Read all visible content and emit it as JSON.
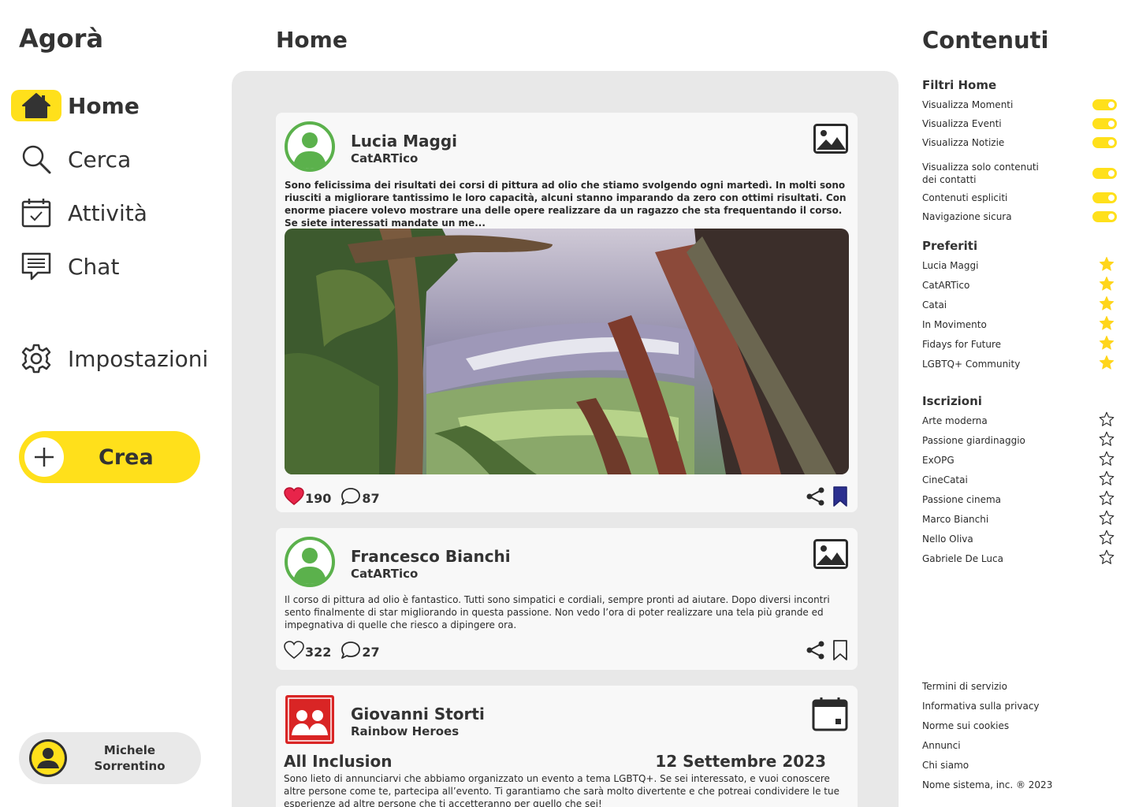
{
  "brand": "Agorà",
  "nav": {
    "home": "Home",
    "search": "Cerca",
    "activity": "Attività",
    "chat": "Chat",
    "settings": "Impostazioni"
  },
  "create_label": "Crea",
  "user": {
    "name_line1": "Michele",
    "name_line2": "Sorrentino"
  },
  "page_title": "Home",
  "posts": [
    {
      "author": "Lucia Maggi",
      "group": "CatARTico",
      "text": "Sono felicissima dei risultati dei corsi di pittura ad olio che stiamo svolgendo ogni martedì. In molti sono riusciti a migliorare tantissimo le loro capacità, alcuni stanno imparando da zero con ottimi risultati. Con enorme piacere volevo mostrare una delle opere realizzare da un ragazzo che sta frequentando il corso. Se siete interessati mandate un me...",
      "likes": "190",
      "comments": "87",
      "liked": true,
      "saved": true,
      "kind_icon": "image-icon"
    },
    {
      "author": "Francesco Bianchi",
      "group": "CatARTico",
      "text": "Il corso di pittura ad olio è fantastico. Tutti sono simpatici e cordiali, sempre pronti ad aiutare. Dopo diversi incontri sento finalmente di star migliorando in questa passione. Non vedo l’ora di poter realizzare una tela più grande ed impegnativa di quelle che riesco a dipingere ora.",
      "likes": "322",
      "comments": "27",
      "liked": false,
      "saved": false,
      "kind_icon": "image-icon"
    },
    {
      "author": "Giovanni Storti",
      "group": "Rainbow Heroes",
      "event_title": "All Inclusion",
      "event_date": "12 Settembre 2023",
      "text": "Sono lieto di annunciarvi che abbiamo organizzato un evento a tema LGBTQ+. Se sei interessato, e vuoi conoscere altre persone come te, partecipa all’evento. Ti garantiamo che sarà molto divertente e che potreai condividere le tue esperienze ad altre persone che ti accetteranno per quello che sei!",
      "kind_icon": "calendar-icon"
    }
  ],
  "right": {
    "title": "Contenuti",
    "filters_title": "Filtri Home",
    "filters": [
      "Visualizza Momenti",
      "Visualizza Eventi",
      "Visualizza Notizie",
      "Visualizza solo contenuti dei contatti",
      "Contenuti espliciti",
      "Navigazione sicura"
    ],
    "favorites_title": "Preferiti",
    "favorites": [
      "Lucia Maggi",
      "CatARTico",
      "Catai",
      "In Movimento",
      "Fidays for Future",
      "LGBTQ+ Community"
    ],
    "subscriptions_title": "Iscrizioni",
    "subscriptions": [
      "Arte moderna",
      "Passione giardinaggio",
      "ExOPG",
      "CineCatai",
      "Passione cinema",
      "Marco Bianchi",
      "Nello Oliva",
      "Gabriele De Luca"
    ],
    "footer": [
      "Termini di servizio",
      "Informativa sulla privacy",
      "Norme sui cookies",
      "Annunci",
      "Chi siamo",
      "Nome sistema, inc. ® 2023"
    ]
  },
  "colors": {
    "accent": "#ffe01b",
    "like": "#e8244a",
    "bookmark": "#2b2f8f",
    "avatar_green": "#5bb14c",
    "group_red": "#d92525"
  }
}
